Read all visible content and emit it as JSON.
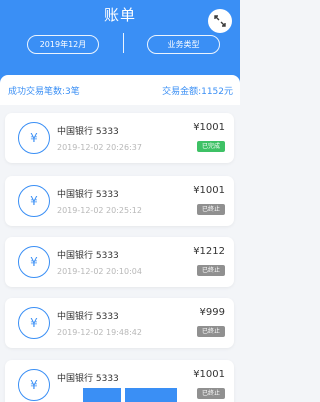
{
  "header": {
    "title": "账单",
    "date_filter": "2019年12月",
    "type_filter": "业务类型"
  },
  "summary": {
    "count": "成功交易笔数:3笔",
    "amount": "交易金额:1152元"
  },
  "transactions": [
    {
      "bank": "中国银行 5333",
      "time": "2019-12-02 20:26:37",
      "amount": "¥1001",
      "status": "已完成"
    },
    {
      "bank": "中国银行 5333",
      "time": "2019-12-02 20:25:12",
      "amount": "¥1001",
      "status": "已终止"
    },
    {
      "bank": "中国银行 5333",
      "time": "2019-12-02 20:10:04",
      "amount": "¥1212",
      "status": "已终止"
    },
    {
      "bank": "中国银行 5333",
      "time": "2019-12-02 19:48:42",
      "amount": "¥999",
      "status": "已终止"
    },
    {
      "bank": "中国银行 5333",
      "time": "",
      "amount": "¥1001",
      "status": "已终止"
    }
  ],
  "icons": {
    "coin": "yen-coin-icon",
    "expand": "expand-icon",
    "coin_glyph": "¥"
  },
  "colors": {
    "accent": "#3a8ff5",
    "done": "#3ec165",
    "stopped": "#909090"
  }
}
